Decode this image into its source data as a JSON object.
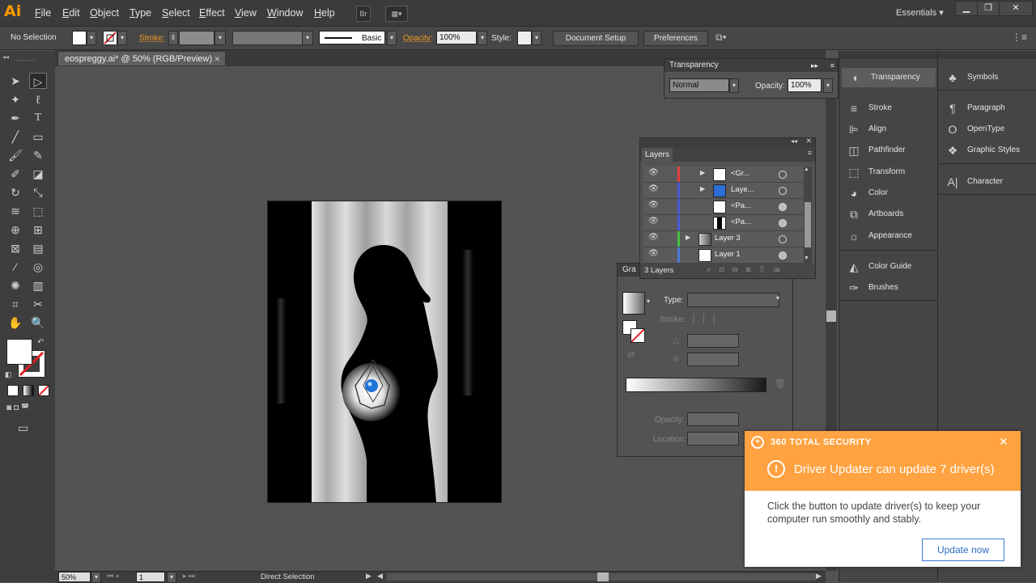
{
  "app": {
    "logo": "Ai",
    "menu": [
      "File",
      "Edit",
      "Object",
      "Type",
      "Select",
      "Effect",
      "View",
      "Window",
      "Help"
    ],
    "workspace": "Essentials"
  },
  "control_bar": {
    "selection": "No Selection",
    "stroke_label": "Stroke:",
    "brush_label": "Basic",
    "opacity_label": "Opacity:",
    "opacity_value": "100%",
    "style_label": "Style:",
    "document_setup": "Document Setup",
    "preferences": "Preferences"
  },
  "document": {
    "tab_title": "eospreggy.ai* @ 50% (RGB/Preview)",
    "close": "✕"
  },
  "status_bar": {
    "zoom": "50%",
    "page": "1",
    "tool_name": "Direct Selection"
  },
  "transparency_panel": {
    "title": "Transparency",
    "blend_mode": "Normal",
    "opacity_label": "Opacity:",
    "opacity_value": "100%"
  },
  "layers_panel": {
    "title": "Layers",
    "rows": [
      {
        "name": "<Gr...",
        "color": "#e04040"
      },
      {
        "name": "Laye...",
        "color": "#4a5cd6"
      },
      {
        "name": "<Pa...",
        "color": "#4a5cd6"
      },
      {
        "name": "<Pa...",
        "color": "#4a5cd6"
      },
      {
        "name": "Layer 3",
        "color": "#43c043"
      },
      {
        "name": "Layer 1",
        "color": "#4a7bd6"
      }
    ],
    "footer": "3 Layers"
  },
  "gradient_panel": {
    "title": "Gra",
    "type_label": "Type:",
    "stroke_label": "Stroke:",
    "opacity_label": "Opacity:",
    "location_label": "Location:"
  },
  "dock_col1": [
    {
      "label": "Transparency",
      "icon": "transparency-icon"
    },
    {
      "label": "Stroke",
      "icon": "stroke-icon"
    },
    {
      "label": "Align",
      "icon": "align-icon"
    },
    {
      "label": "Pathfinder",
      "icon": "pathfinder-icon"
    },
    {
      "label": "Transform",
      "icon": "transform-icon"
    },
    {
      "label": "Color",
      "icon": "color-icon"
    },
    {
      "label": "Artboards",
      "icon": "artboards-icon"
    },
    {
      "label": "Appearance",
      "icon": "appearance-icon"
    },
    {
      "label": "Color Guide",
      "icon": "color-guide-icon"
    },
    {
      "label": "Brushes",
      "icon": "brushes-icon"
    }
  ],
  "dock_col2": [
    {
      "label": "Symbols",
      "icon": "symbols-icon"
    },
    {
      "label": "Paragraph",
      "icon": "paragraph-icon"
    },
    {
      "label": "OpenType",
      "icon": "opentype-icon"
    },
    {
      "label": "Graphic Styles",
      "icon": "graphic-styles-icon"
    },
    {
      "label": "Character",
      "icon": "character-icon"
    }
  ],
  "notification": {
    "brand": "360 TOTAL SECURITY",
    "headline": "Driver Updater can update 7 driver(s)",
    "body": "Click the button to update driver(s) to keep your computer run smoothly and stably.",
    "button": "Update now",
    "accent": "#ffa241"
  }
}
